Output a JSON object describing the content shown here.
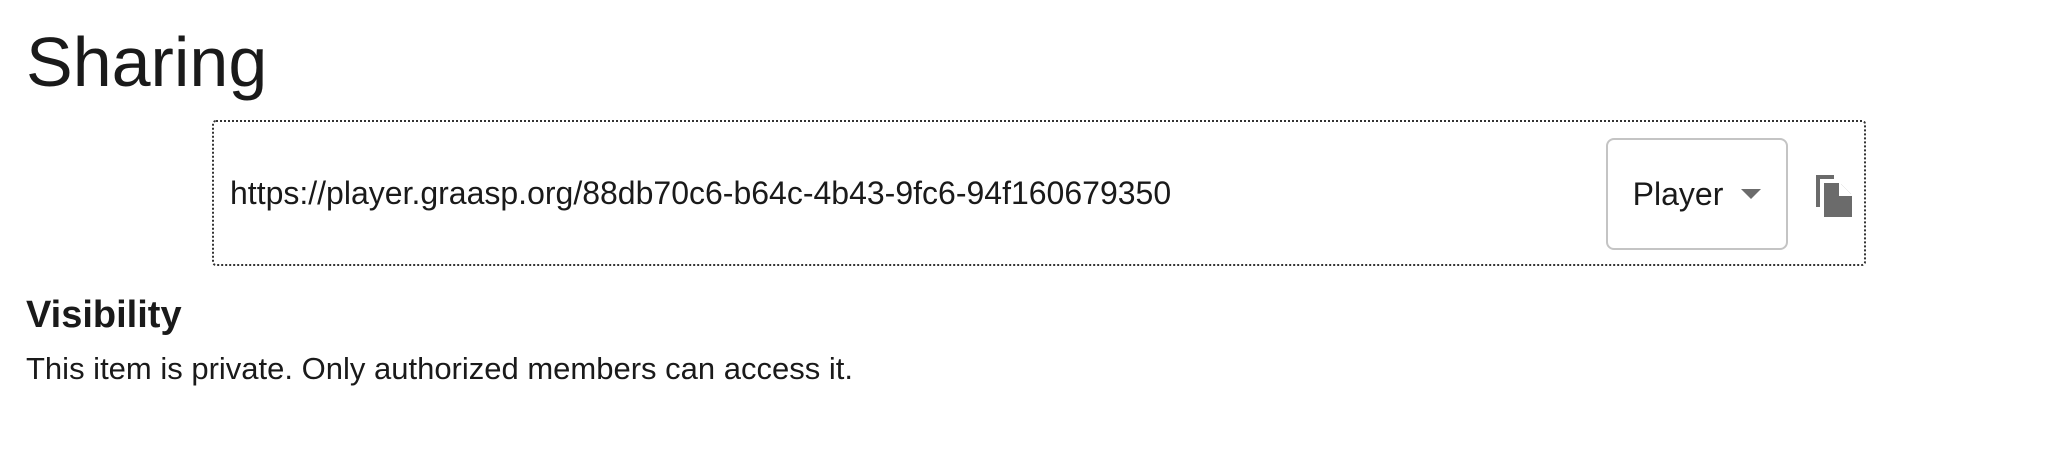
{
  "page": {
    "title": "Sharing"
  },
  "share": {
    "link": "https://player.graasp.org/88db70c6-b64c-4b43-9fc6-94f160679350",
    "platform_select": {
      "value": "Player"
    },
    "copy_icon": "copy-icon"
  },
  "visibility": {
    "title": "Visibility",
    "text": "This item is private. Only authorized members can access it."
  },
  "colors": {
    "text": "#1a1a1a",
    "border": "#c4c4c4",
    "icon": "#6b6b6b"
  }
}
